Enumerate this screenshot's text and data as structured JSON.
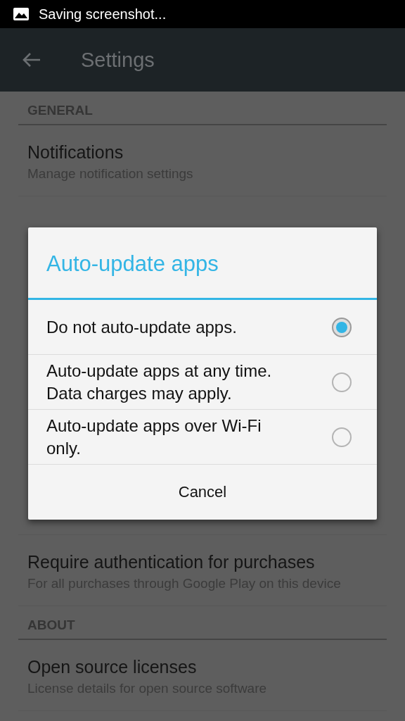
{
  "status_bar": {
    "text": "Saving screenshot..."
  },
  "toolbar": {
    "title": "Settings"
  },
  "sections": [
    {
      "header": "GENERAL",
      "items": [
        {
          "title": "Notifications",
          "subtitle": "Manage notification settings"
        }
      ]
    },
    {
      "items": [
        {
          "title": "Require authentication for purchases",
          "subtitle": "For all purchases through Google Play on this device"
        }
      ]
    },
    {
      "header": "ABOUT",
      "items": [
        {
          "title": "Open source licenses",
          "subtitle": "License details for open source software"
        }
      ]
    }
  ],
  "dialog": {
    "title": "Auto-update apps",
    "options": [
      {
        "label": "Do not auto-update apps.",
        "selected": true
      },
      {
        "label": "Auto-update apps at any time. Data charges may apply.",
        "selected": false
      },
      {
        "label": "Auto-update apps over Wi-Fi only.",
        "selected": false
      }
    ],
    "buttons": [
      "Cancel"
    ]
  }
}
